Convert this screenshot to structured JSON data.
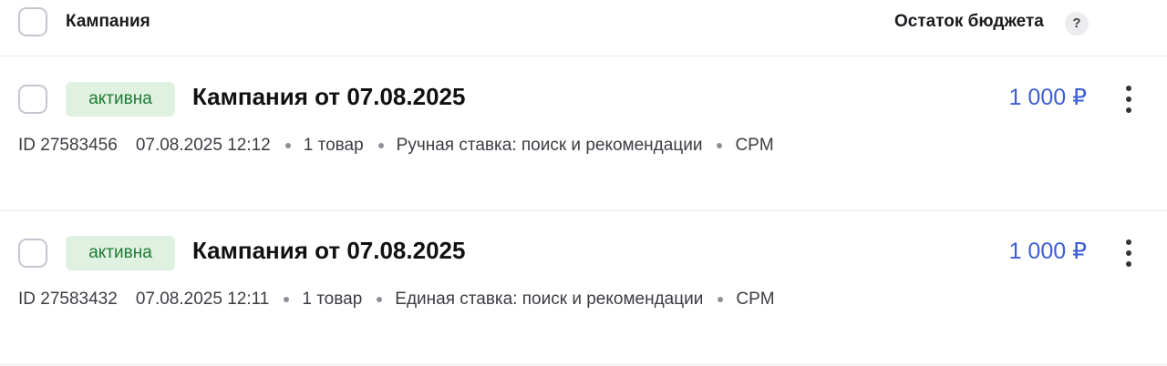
{
  "header": {
    "campaign_label": "Кампания",
    "budget_label": "Остаток бюджета",
    "help_glyph": "?"
  },
  "rows": [
    {
      "status": "активна",
      "name": "Кампания от 07.08.2025",
      "budget": "1 000 ₽",
      "id": "ID 27583456",
      "datetime": "07.08.2025 12:12",
      "products": "1 товар",
      "bid_type": "Ручная ставка: поиск и рекомендации",
      "pricing": "CPM"
    },
    {
      "status": "активна",
      "name": "Кампания от 07.08.2025",
      "budget": "1 000 ₽",
      "id": "ID 27583432",
      "datetime": "07.08.2025 12:11",
      "products": "1 товар",
      "bid_type": "Единая ставка: поиск и рекомендации",
      "pricing": "CPM"
    }
  ],
  "colors": {
    "accent_budget": "#3d5fd8",
    "status_bg": "#dff2e1",
    "status_text": "#1f7a33"
  },
  "icons": {
    "row_menu": "more-vertical-icon",
    "help": "question-mark-icon"
  }
}
